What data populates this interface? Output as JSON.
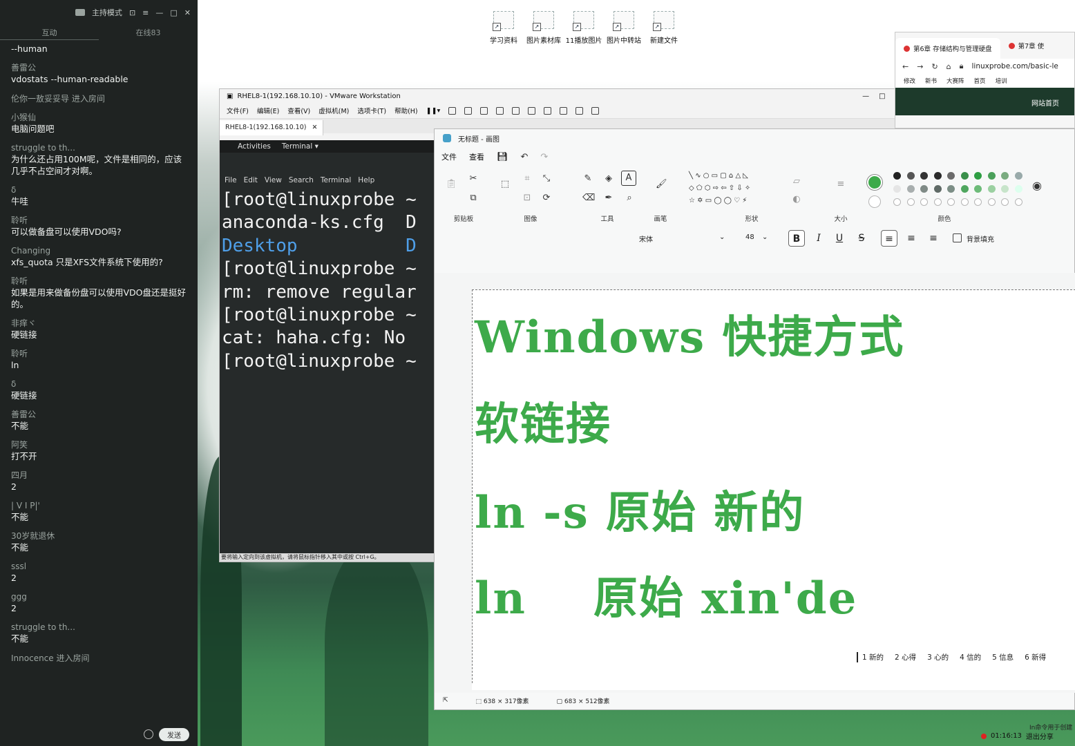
{
  "desktop": {
    "icons": [
      {
        "label": "学习资料",
        "icon": "shortcut-icon"
      },
      {
        "label": "图片素材库",
        "icon": "shortcut-icon"
      },
      {
        "label": "11播放图片",
        "icon": "shortcut-icon"
      },
      {
        "label": "图片中转站",
        "icon": "shortcut-icon"
      },
      {
        "label": "新建文件",
        "icon": "shortcut-icon"
      }
    ]
  },
  "chat": {
    "mode_label": "主持模式",
    "tabs": [
      "互动",
      "在线83"
    ],
    "messages": [
      {
        "user": "",
        "text": "--human"
      },
      {
        "user": "善雷公",
        "text": "vdostats --human-readable"
      },
      {
        "system": "伦你一敖妥妥导 进入房间"
      },
      {
        "user": "小猴仙",
        "text": "电脑问题吧"
      },
      {
        "user": "struggle to th...",
        "text": "为什么还占用100M呢，文件是相同的，应该几乎不占空间才对啊。"
      },
      {
        "user": "δ",
        "text": "牛哇"
      },
      {
        "user": "聆听",
        "text": "可以做备盘可以使用VDO吗?"
      },
      {
        "user": "Changing",
        "text": "xfs_quota 只是XFS文件系统下使用的?"
      },
      {
        "user": "聆听",
        "text": "如果是用来做备份盘可以使用VDO盘还是挺好的。"
      },
      {
        "user": "非痒ヾ",
        "text": "硬链接"
      },
      {
        "user": "聆听",
        "text": "ln"
      },
      {
        "user": "δ",
        "text": "硬链接"
      },
      {
        "user": "善雷公",
        "text": "不能"
      },
      {
        "user": "阿笑",
        "text": "打不开"
      },
      {
        "user": "四月",
        "text": "2"
      },
      {
        "user": "|     V     I      P|'",
        "text": "不能"
      },
      {
        "user": "30岁就退休",
        "text": "不能"
      },
      {
        "user": "sssl",
        "text": "2"
      },
      {
        "user": "ggg",
        "text": "2"
      },
      {
        "user": "struggle to th...",
        "text": "不能"
      },
      {
        "system": "Innocence 进入房间"
      }
    ],
    "send_label": "发送"
  },
  "vmware": {
    "title": "RHEL8-1(192.168.10.10) - VMware Workstation",
    "menu": [
      "文件(F)",
      "编辑(E)",
      "查看(V)",
      "虚拟机(M)",
      "选项卡(T)",
      "帮助(H)"
    ],
    "tab_label": "RHEL8-1(192.168.10.10)",
    "gnome": {
      "activities": "Activities",
      "terminal": "Terminal ▾"
    },
    "terminal_menu": [
      "File",
      "Edit",
      "View",
      "Search",
      "Terminal",
      "Help"
    ],
    "terminal_lines": [
      {
        "text": "[root@linuxprobe ~",
        "dir": false
      },
      {
        "text": "anaconda-ks.cfg  D",
        "dir": false
      },
      {
        "text": "Desktop          D",
        "dir": true
      },
      {
        "text": "[root@linuxprobe ~",
        "dir": false
      },
      {
        "text": "rm: remove regular",
        "dir": false
      },
      {
        "text": "[root@linuxprobe ~",
        "dir": false
      },
      {
        "text": "cat: haha.cfg: No ",
        "dir": false
      },
      {
        "text": "[root@linuxprobe ~",
        "dir": false
      }
    ],
    "status": "要将输入定向到该虚拟机，请将鼠标指针移入其中或按 Ctrl+G。"
  },
  "browser": {
    "tabs": [
      "第6章 存储结构与管理硬盘",
      "第7章 使"
    ],
    "url": "linuxprobe.com/basic-le",
    "bookmarks": [
      "修改",
      "新书",
      "大赛阵",
      "首页",
      "培训"
    ],
    "site_link": "网站首页"
  },
  "paint": {
    "title": "无标题 - 画图",
    "menu": [
      "文件",
      "查看"
    ],
    "groups": [
      "剪贴板",
      "图像",
      "工具",
      "画笔",
      "形状",
      "大小",
      "颜色"
    ],
    "font": "宋体",
    "font_size": "48",
    "bg_fill_label": "背景填充",
    "canvas_lines": [
      "Windows 快捷方式",
      "软链接",
      "ln -s 原始 新的",
      "ln    原始 xin'de"
    ],
    "ime_candidates": [
      "1 新的",
      "2 心得",
      "3 心的",
      "4 信的",
      "5 信息",
      "6 新得"
    ],
    "status": {
      "selection": "638 × 317像素",
      "canvas": "683 × 512像素"
    },
    "palette": {
      "primary": "#3daa4a",
      "row1": [
        "#222222",
        "#555555",
        "#333333",
        "#2b2b2b",
        "#6b6b6b",
        "#3a8f4a",
        "#2e9e43",
        "#4aa05a",
        "#7aab80",
        "#9aa"
      ],
      "row2": [
        "#e5e5e5",
        "#a8aeae",
        "#7f8a86",
        "#5f6a66",
        "#7c8e86",
        "#4fa65e",
        "#6dbb79",
        "#9bd0a1",
        "#c7e4ca",
        "#dfe"
      ]
    }
  },
  "recording": {
    "time": "01:16:13",
    "exit": "退出分享",
    "top": "In命令用于创建"
  }
}
